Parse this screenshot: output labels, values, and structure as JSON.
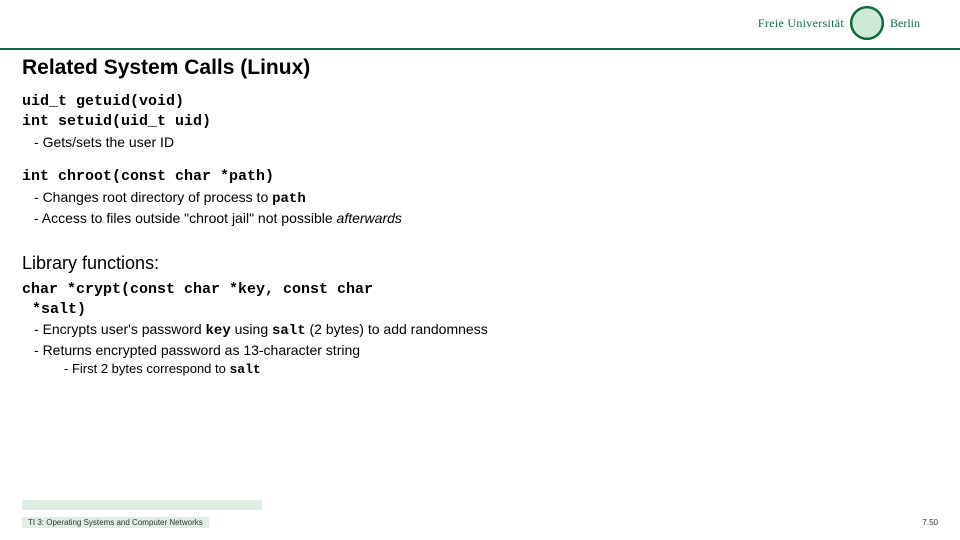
{
  "header": {
    "brand_left": "Freie Universität",
    "brand_right": "Berlin"
  },
  "title": "Related System Calls (Linux)",
  "block1": {
    "code1": "uid_t getuid(void)",
    "code2": "int setuid(uid_t uid)",
    "bullet1": "Gets/sets the user ID"
  },
  "block2": {
    "code": "int chroot(const char *path)",
    "bullet1_pre": "Changes root directory of process to ",
    "bullet1_code": "path",
    "bullet2_pre": "Access to files outside \"chroot jail\" not possible ",
    "bullet2_em": "afterwards"
  },
  "lib_heading": "Library functions:",
  "block3": {
    "code_l1": "char *crypt(const char *key, const char",
    "code_l2": "*salt)",
    "bullet1_pre": "Encrypts user's password ",
    "bullet1_code1": "key",
    "bullet1_mid": " using ",
    "bullet1_code2": "salt",
    "bullet1_post": " (2 bytes) to add randomness",
    "bullet2": "Returns encrypted password as 13-character string",
    "sub_bullet_pre": "First 2 bytes correspond to ",
    "sub_bullet_code": "salt"
  },
  "footer": {
    "left": "TI 3: Operating Systems and Computer Networks",
    "right": "7.50"
  }
}
